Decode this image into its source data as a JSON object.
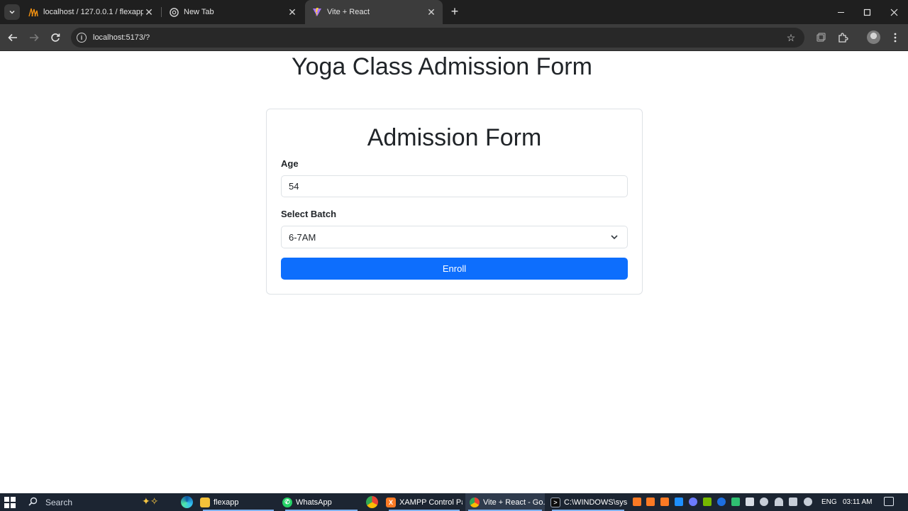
{
  "browser": {
    "tabs": [
      {
        "title": "localhost / 127.0.0.1 / flexapp /",
        "favicon": "phpmyadmin-icon",
        "active": false
      },
      {
        "title": "New Tab",
        "favicon": "chrome-icon",
        "active": false
      },
      {
        "title": "Vite + React",
        "favicon": "vite-icon",
        "active": true
      }
    ],
    "url": "localhost:5173/?"
  },
  "page": {
    "title": "Yoga Class Admission Form",
    "form": {
      "title": "Admission Form",
      "age_label": "Age",
      "age_value": "54",
      "batch_label": "Select Batch",
      "batch_value": "6-7AM",
      "submit_label": "Enroll"
    }
  },
  "taskbar": {
    "search_placeholder": "Search",
    "apps": [
      {
        "label": "flexapp",
        "icon": "folder-icon"
      },
      {
        "label": "WhatsApp",
        "icon": "whatsapp-icon"
      },
      {
        "label": "XAMPP Control Pa...",
        "icon": "xampp-icon"
      },
      {
        "label": "Vite + React - Go...",
        "icon": "chrome-icon"
      },
      {
        "label": "C:\\WINDOWS\\syst...",
        "icon": "cmd-icon"
      }
    ],
    "language": "ENG",
    "time": "03:11 AM"
  },
  "colors": {
    "primary": "#0d6efd",
    "chrome_dark": "#1f1f1f",
    "chrome_toolbar": "#3c3c3c",
    "taskbar": "#1c2532"
  }
}
